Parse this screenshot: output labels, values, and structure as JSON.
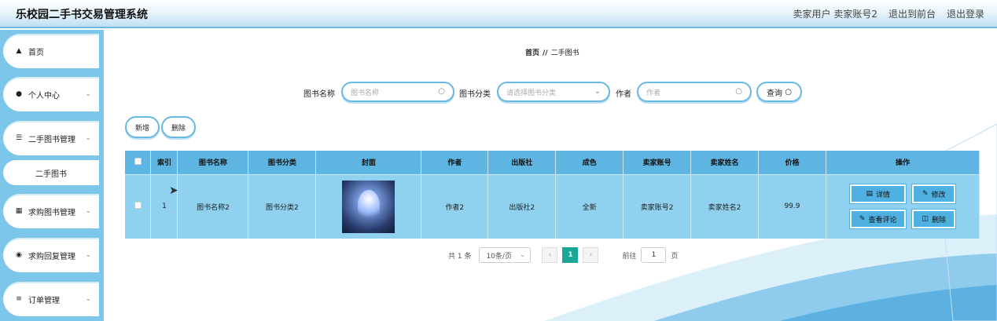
{
  "header": {
    "title": "乐校园二手书交易管理系统",
    "user_role": "卖家用户",
    "user_name": "卖家账号2",
    "to_frontend": "退出到前台",
    "logout": "退出登录"
  },
  "sidebar": {
    "items": [
      {
        "label": "首页",
        "icon": "home-icon"
      },
      {
        "label": "个人中心",
        "icon": "user-icon"
      },
      {
        "label": "二手图书管理",
        "icon": "sliders-icon"
      },
      {
        "label": "求购图书管理",
        "icon": "grid-icon"
      },
      {
        "label": "求购回复管理",
        "icon": "location-pin-icon"
      },
      {
        "label": "订单管理",
        "icon": "list-icon"
      }
    ],
    "submenu_active": "二手图书"
  },
  "breadcrumb": {
    "home": "首页",
    "separator": "//",
    "current": "二手图书"
  },
  "search": {
    "book_name_label": "图书名称",
    "book_name_placeholder": "图书名称",
    "category_label": "图书分类",
    "category_placeholder": "请选择图书分类",
    "author_label": "作者",
    "author_placeholder": "作者",
    "query_button": "查询"
  },
  "actions": {
    "add": "新增",
    "delete": "删除"
  },
  "table": {
    "headers": [
      "索引",
      "图书名称",
      "图书分类",
      "封面",
      "作者",
      "出版社",
      "成色",
      "卖家账号",
      "卖家姓名",
      "价格",
      "操作"
    ],
    "rows": [
      {
        "index": "1",
        "name": "图书名称2",
        "category": "图书分类2",
        "author": "作者2",
        "publisher": "出版社2",
        "condition": "全新",
        "seller_account": "卖家账号2",
        "seller_name": "卖家姓名2",
        "price": "99.9"
      }
    ],
    "row_actions": {
      "detail": "详情",
      "edit": "修改",
      "comments": "查看评论",
      "delete": "删除"
    }
  },
  "pagination": {
    "total": "共 1 条",
    "page_size": "10条/页",
    "current_page": "1",
    "goto_prefix": "前往",
    "goto_value": "1",
    "goto_suffix": "页"
  },
  "colors": {
    "accent": "#5eb5e1",
    "row": "#8fd1ef",
    "active_page": "#1aa79a"
  }
}
